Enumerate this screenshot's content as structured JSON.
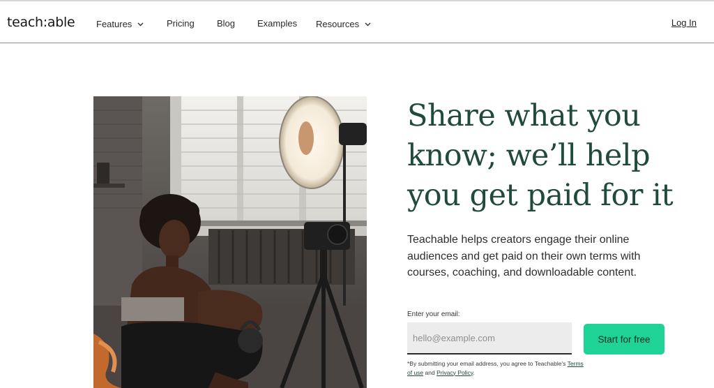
{
  "brand": {
    "logo_text": "teach:able"
  },
  "nav": {
    "items": [
      {
        "label": "Features",
        "has_dropdown": true
      },
      {
        "label": "Pricing",
        "has_dropdown": false
      },
      {
        "label": "Blog",
        "has_dropdown": false
      },
      {
        "label": "Examples",
        "has_dropdown": false
      },
      {
        "label": "Resources",
        "has_dropdown": true
      }
    ],
    "login_label": "Log In"
  },
  "hero": {
    "headline_lines": [
      "Share what you",
      "know; we’ll help",
      "you get paid for it"
    ],
    "subtext": "Teachable helps creators engage their online audiences and get paid on their own terms with courses, coaching, and downloadable content.",
    "form": {
      "email_label": "Enter your email:",
      "email_placeholder": "hello@example.com",
      "cta_label": "Start for free"
    },
    "legal": {
      "prefix": "*By submitting your email address, you agree to Teachable’s ",
      "terms_label": "Terms of use",
      "and": " and ",
      "privacy_label": "Privacy Policy",
      "suffix": "."
    }
  },
  "colors": {
    "headline": "#1f4a3d",
    "cta_bg": "#1fd396",
    "header_border": "#8c8c8c",
    "input_bg": "#ececec"
  },
  "icons": {
    "dropdown": "chevron-down-icon"
  }
}
